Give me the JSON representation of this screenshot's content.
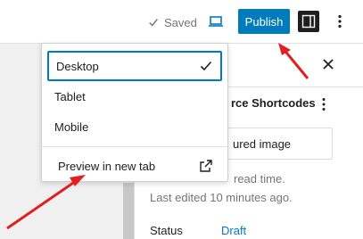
{
  "toolbar": {
    "saved_label": "Saved",
    "publish_label": "Publish"
  },
  "sidebar": {
    "post_title": "rce Shortcodes",
    "featured_image_label": "ured image",
    "read_time": "read time.",
    "last_edited": "Last edited 10 minutes ago.",
    "status_label": "Status",
    "status_value": "Draft"
  },
  "dropdown": {
    "items": [
      {
        "label": "Desktop",
        "selected": true
      },
      {
        "label": "Tablet",
        "selected": false
      },
      {
        "label": "Mobile",
        "selected": false
      }
    ],
    "preview_label": "Preview in new tab"
  },
  "colors": {
    "accent": "#007cba",
    "annotation": "#e02020"
  },
  "icons": {
    "saved": "check-icon",
    "device": "laptop-icon",
    "sidebar": "sidebar-toggle-icon",
    "more": "vertical-ellipsis-icon",
    "close": "close-icon",
    "selected": "checkmark-icon",
    "external": "external-link-icon"
  }
}
